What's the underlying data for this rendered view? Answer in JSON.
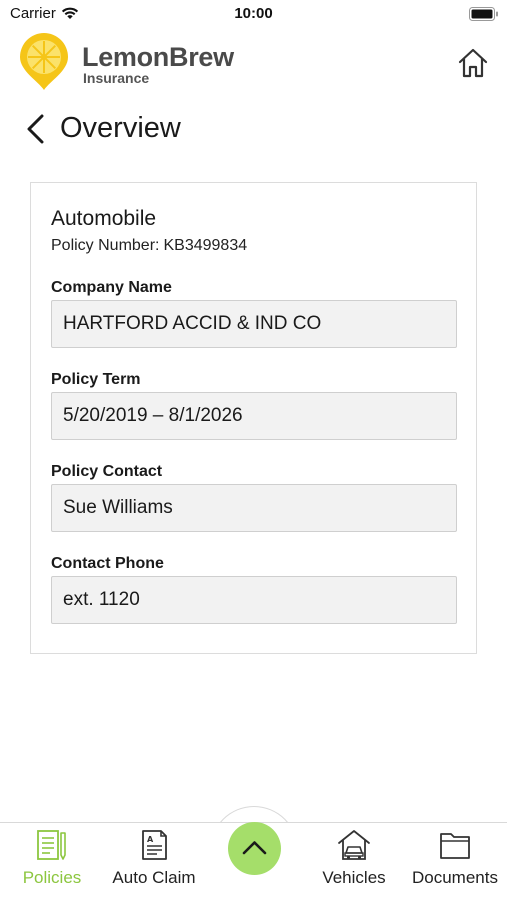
{
  "status_bar": {
    "carrier": "Carrier",
    "time": "10:00"
  },
  "brand": {
    "name": "LemonBrew",
    "subtitle": "Insurance"
  },
  "page": {
    "title": "Overview"
  },
  "policy": {
    "type": "Automobile",
    "number_label": "Policy Number:",
    "number": "KB3499834",
    "fields": [
      {
        "label": "Company Name",
        "value": "HARTFORD ACCID & IND CO"
      },
      {
        "label": "Policy Term",
        "value": "5/20/2019 – 8/1/2026"
      },
      {
        "label": "Policy Contact",
        "value": "Sue Williams"
      },
      {
        "label": "Contact Phone",
        "value": "ext. 1120"
      }
    ]
  },
  "tabs": [
    {
      "label": "Policies",
      "icon": "policies-icon",
      "active": true
    },
    {
      "label": "Auto Claim",
      "icon": "auto-claim-icon",
      "active": false
    },
    {
      "label": "Vehicles",
      "icon": "vehicles-icon",
      "active": false
    },
    {
      "label": "Documents",
      "icon": "documents-icon",
      "active": false
    }
  ],
  "colors": {
    "accent": "#8cc63f",
    "center_button": "#a5de6a",
    "logo": "#f5c518"
  }
}
